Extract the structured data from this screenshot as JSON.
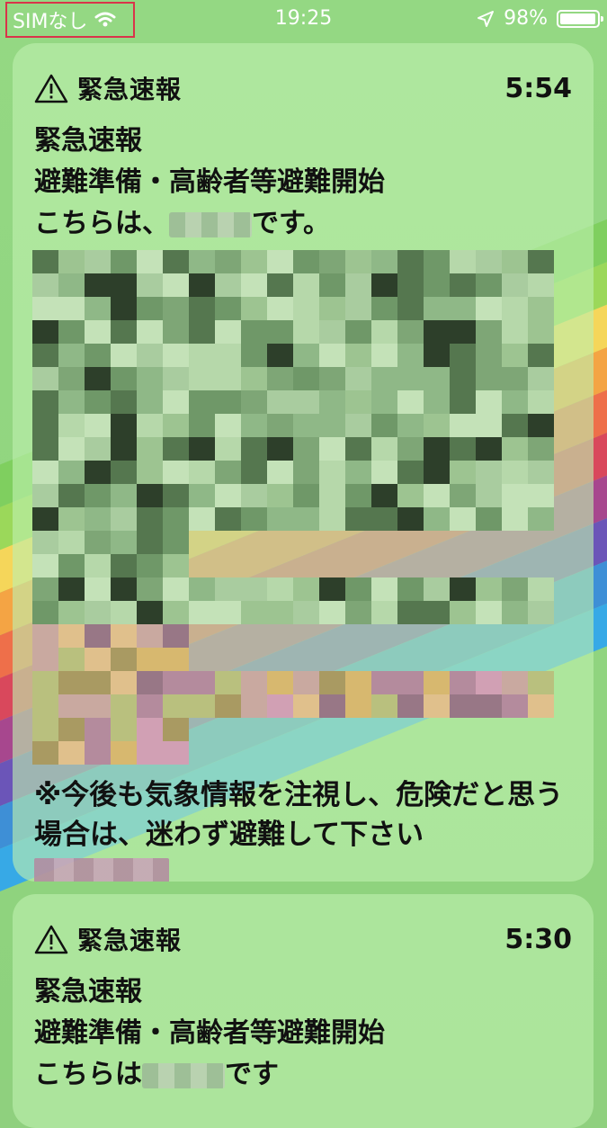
{
  "status_bar": {
    "carrier": "SIMなし",
    "time": "19:25",
    "battery_percent": "98%",
    "battery_level": 0.98
  },
  "notifications": [
    {
      "app": "緊急速報",
      "time": "5:54",
      "title": "緊急速報",
      "line1": "避難準備・高齢者等避難開始",
      "line2_prefix": "こちらは、",
      "line2_suffix": "です。",
      "note": "※今後も気象情報を注視し、危険だと思う場合は、迷わず避難して下さい"
    },
    {
      "app": "緊急速報",
      "time": "5:30",
      "title": "緊急速報",
      "line1": "避難準備・高齢者等避難開始",
      "line2_prefix": "こちらは",
      "line2_suffix": "です"
    }
  ],
  "icons": {
    "wifi": "wifi-icon",
    "location": "location-arrow-icon",
    "battery": "battery-icon",
    "warning": "warning-triangle-icon"
  },
  "colors": {
    "status_highlight": "#d9344a",
    "card_background": "rgba(190,240,175,0.62)"
  }
}
